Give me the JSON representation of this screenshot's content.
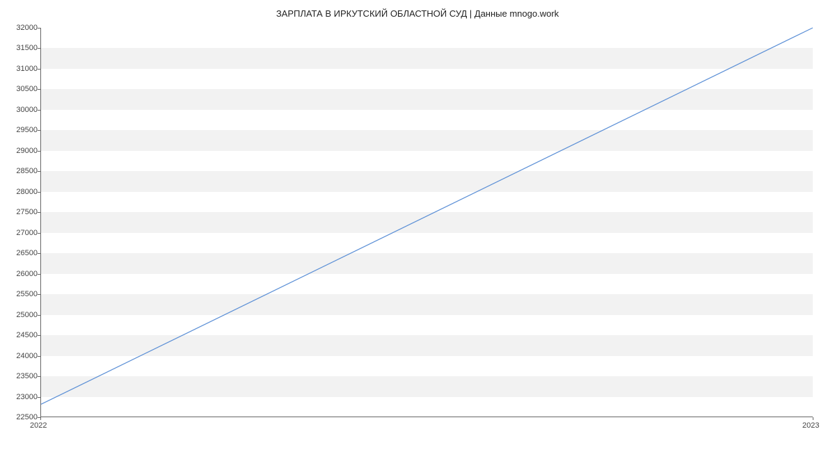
{
  "chart_data": {
    "type": "line",
    "title": "ЗАРПЛАТА В ИРКУТСКИЙ ОБЛАСТНОЙ СУД | Данные mnogo.work",
    "x": [
      "2022",
      "2023"
    ],
    "values": [
      22800,
      32000
    ],
    "xlabel": "",
    "ylabel": "",
    "ylim": [
      22500,
      32000
    ],
    "yticks": [
      22500,
      23000,
      23500,
      24000,
      24500,
      25000,
      25500,
      26000,
      26500,
      27000,
      27500,
      28000,
      28500,
      29000,
      29500,
      30000,
      30500,
      31000,
      31500,
      32000
    ],
    "xticks": [
      "2022",
      "2023"
    ],
    "line_color": "#5b8fd6",
    "grid": true
  }
}
